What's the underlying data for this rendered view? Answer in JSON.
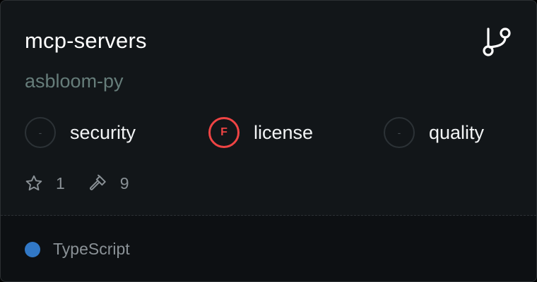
{
  "repo": {
    "name": "mcp-servers",
    "owner": "asbloom-py"
  },
  "scores": {
    "security": {
      "label": "security",
      "grade": "-"
    },
    "license": {
      "label": "license",
      "grade": "F",
      "grade_color": "#ef4444"
    },
    "quality": {
      "label": "quality",
      "grade": "-"
    }
  },
  "stats": {
    "stars": "1",
    "tools": "9"
  },
  "icons": {
    "header": "git-branch-icon",
    "stars": "star-icon",
    "tools": "hammer-icon"
  },
  "footer": {
    "language": "TypeScript",
    "language_color": "#3178c6"
  }
}
